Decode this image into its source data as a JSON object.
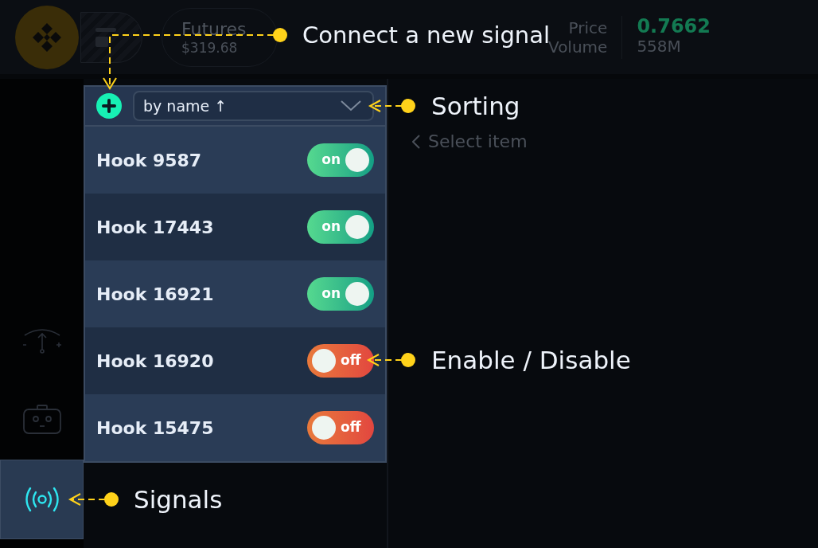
{
  "header": {
    "futures_label": "Futures",
    "futures_value": "$319.68",
    "price_label": "Price",
    "volume_label": "Volume",
    "price": "0.7662",
    "volume": "558M"
  },
  "sidebar": {
    "items": [
      {
        "kind": "gauge",
        "selected": false
      },
      {
        "kind": "robot",
        "selected": false
      },
      {
        "kind": "signals",
        "selected": true
      }
    ]
  },
  "panel": {
    "sort": "by name ↑",
    "hooks": [
      {
        "name": "Hook 9587",
        "on": true,
        "toggle": "on"
      },
      {
        "name": "Hook 17443",
        "on": true,
        "toggle": "on"
      },
      {
        "name": "Hook 16921",
        "on": true,
        "toggle": "on"
      },
      {
        "name": "Hook 16920",
        "on": false,
        "toggle": "off"
      },
      {
        "name": "Hook 15475",
        "on": false,
        "toggle": "off"
      }
    ]
  },
  "content": {
    "back_link": "Select item"
  },
  "annotations": [
    {
      "text": "Connect a new signal"
    },
    {
      "text": "Sorting"
    },
    {
      "text": "Enable / Disable"
    },
    {
      "text": "Signals"
    }
  ]
}
